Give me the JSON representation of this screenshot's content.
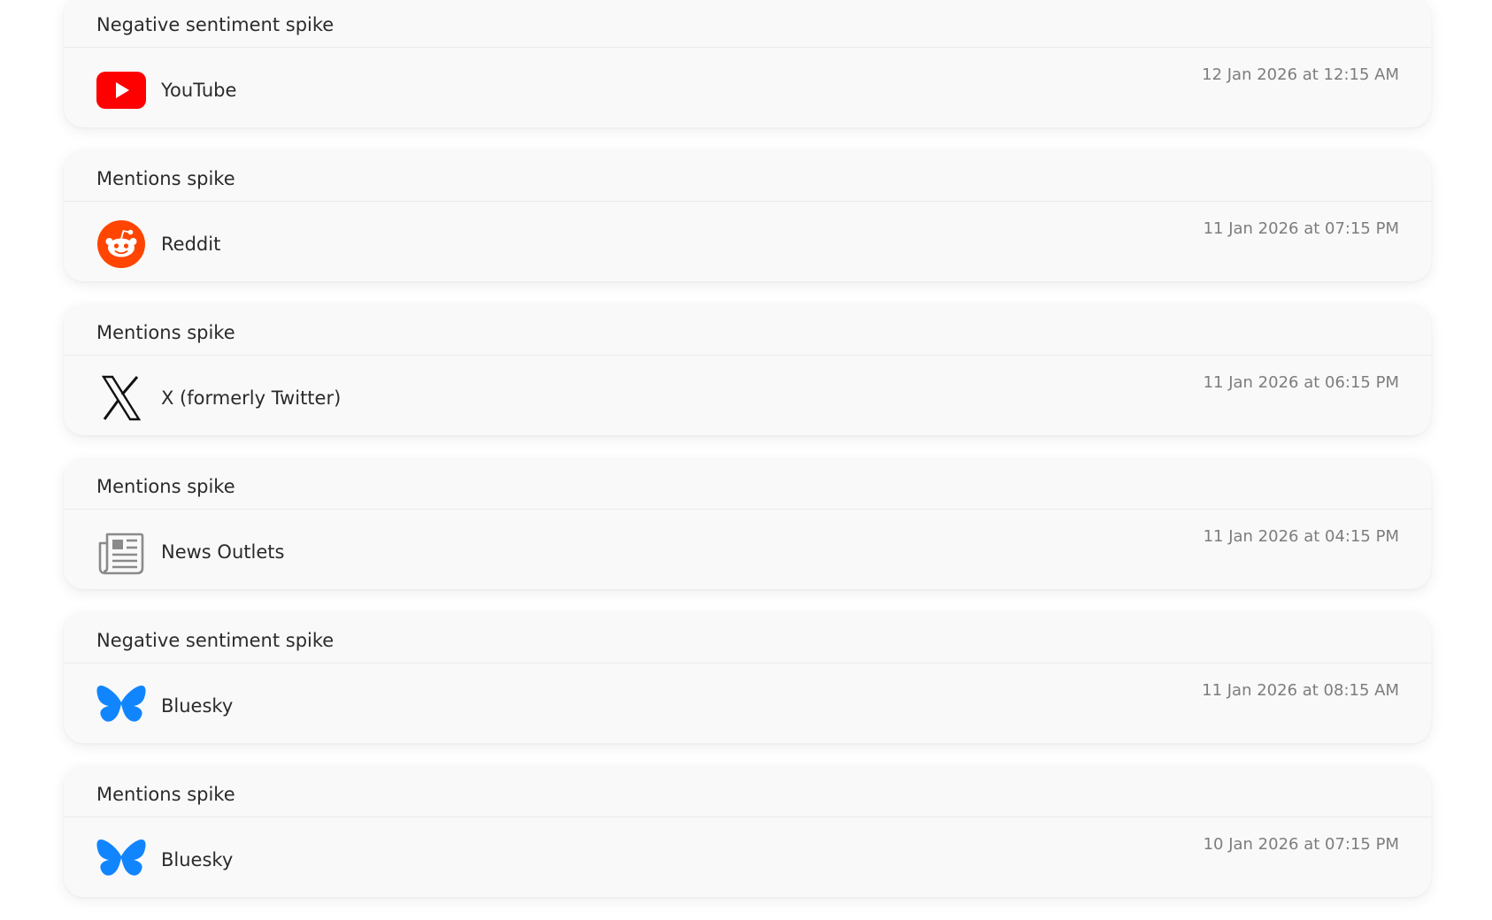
{
  "alerts": [
    {
      "title": "Negative sentiment spike",
      "source": "YouTube",
      "source_icon": "youtube-icon",
      "time": "12 Jan 2026 at 12:15 AM"
    },
    {
      "title": "Mentions spike",
      "source": "Reddit",
      "source_icon": "reddit-icon",
      "time": "11 Jan 2026 at 07:15 PM"
    },
    {
      "title": "Mentions spike",
      "source": "X (formerly Twitter)",
      "source_icon": "x-icon",
      "time": "11 Jan 2026 at 06:15 PM"
    },
    {
      "title": "Mentions spike",
      "source": "News Outlets",
      "source_icon": "newspaper-icon",
      "time": "11 Jan 2026 at 04:15 PM"
    },
    {
      "title": "Negative sentiment spike",
      "source": "Bluesky",
      "source_icon": "bluesky-icon",
      "time": "11 Jan 2026 at 08:15 AM"
    },
    {
      "title": "Mentions spike",
      "source": "Bluesky",
      "source_icon": "bluesky-icon",
      "time": "10 Jan 2026 at 07:15 PM"
    }
  ],
  "colors": {
    "youtube": "#ff0000",
    "reddit": "#ff4500",
    "bluesky": "#1185fe",
    "x": "#111111",
    "news": "#8a8a8a"
  }
}
